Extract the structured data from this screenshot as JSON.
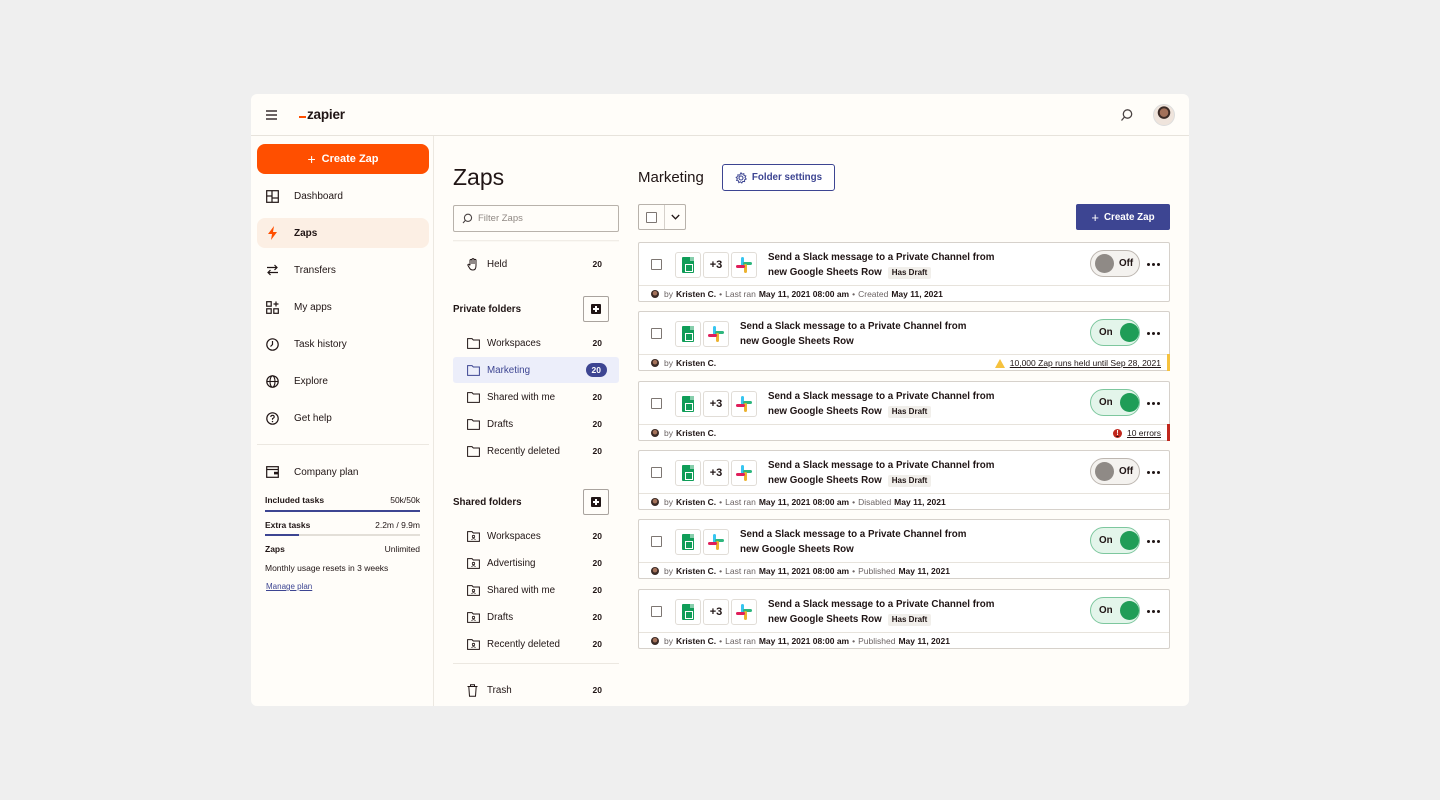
{
  "app": {
    "logo": "zapier"
  },
  "sidebar": {
    "create_label": "Create Zap",
    "items": [
      {
        "label": "Dashboard",
        "icon": "dashboard-icon"
      },
      {
        "label": "Zaps",
        "icon": "zap-bolt-icon"
      },
      {
        "label": "Transfers",
        "icon": "transfers-icon"
      },
      {
        "label": "My apps",
        "icon": "apps-grid-icon"
      },
      {
        "label": "Task history",
        "icon": "clock-icon"
      },
      {
        "label": "Explore",
        "icon": "globe-icon"
      },
      {
        "label": "Get help",
        "icon": "help-icon"
      }
    ],
    "plan": {
      "label": "Company plan",
      "included_label": "Included tasks",
      "included_value": "50k/50k",
      "included_fraction": 1.0,
      "extra_label": "Extra tasks",
      "extra_value": "2.2m / 9.9m",
      "extra_fraction": 0.22,
      "zaps_label": "Zaps",
      "zaps_value": "Unlimited",
      "reset_note": "Monthly usage resets in 3 weeks",
      "manage_label": "Manage plan"
    }
  },
  "folders": {
    "title": "Zaps",
    "filter_placeholder": "Filter Zaps",
    "held": {
      "label": "Held",
      "count": "20"
    },
    "private_heading": "Private folders",
    "private": [
      {
        "label": "Workspaces",
        "count": "20"
      },
      {
        "label": "Marketing",
        "count": "20"
      },
      {
        "label": "Shared with me",
        "count": "20"
      },
      {
        "label": "Drafts",
        "count": "20"
      },
      {
        "label": "Recently deleted",
        "count": "20"
      }
    ],
    "shared_heading": "Shared folders",
    "shared": [
      {
        "label": "Workspaces",
        "count": "20"
      },
      {
        "label": "Advertising",
        "count": "20"
      },
      {
        "label": "Shared with me",
        "count": "20"
      },
      {
        "label": "Drafts",
        "count": "20"
      },
      {
        "label": "Recently deleted",
        "count": "20"
      }
    ],
    "trash": {
      "label": "Trash",
      "count": "20"
    }
  },
  "main": {
    "folder_title": "Marketing",
    "folder_settings_label": "Folder settings",
    "create_label": "Create Zap",
    "zaps": [
      {
        "title": "Send a Slack message to a Private Channel from new Google Sheets Row",
        "extra": "+3",
        "draft": "Has Draft",
        "state": "Off",
        "by": "by",
        "author": "Kristen C.",
        "l1": "Last ran",
        "v1": "May 11, 2021 08:00 am",
        "l2": "Created",
        "v2": "May 11, 2021"
      },
      {
        "title": "Send a Slack message to a Private Channel from new Google Sheets Row",
        "extra": "",
        "draft": "",
        "state": "On",
        "by": "by",
        "author": "Kristen C.",
        "alert": "10,000 Zap runs held until Sep 28, 2021"
      },
      {
        "title": "Send a Slack message to a Private Channel from new Google Sheets Row",
        "extra": "+3",
        "draft": "Has Draft",
        "state": "On",
        "by": "by",
        "author": "Kristen C.",
        "alert": "10 errors"
      },
      {
        "title": "Send a Slack message to a Private Channel from new Google Sheets Row",
        "extra": "+3",
        "draft": "Has Draft",
        "state": "Off",
        "by": "by",
        "author": "Kristen C.",
        "l1": "Last ran",
        "v1": "May 11, 2021 08:00 am",
        "l2": "Disabled",
        "v2": "May 11, 2021"
      },
      {
        "title": "Send a Slack message to a Private Channel from new Google Sheets Row",
        "extra": "",
        "draft": "",
        "state": "On",
        "by": "by",
        "author": "Kristen C.",
        "l1": "Last ran",
        "v1": "May 11, 2021 08:00 am",
        "l2": "Published",
        "v2": "May 11, 2021"
      },
      {
        "title": "Send a Slack message to a Private Channel from new Google Sheets Row",
        "extra": "+3",
        "draft": "Has Draft",
        "state": "On",
        "by": "by",
        "author": "Kristen C.",
        "l1": "Last ran",
        "v1": "May 11, 2021 08:00 am",
        "l2": "Published",
        "v2": "May 11, 2021"
      }
    ]
  },
  "colors": {
    "brand": "#ff4f00",
    "accent": "#3d4592",
    "on": "#1f9d57",
    "warning": "#f6c23e",
    "error": "#c1271d"
  }
}
